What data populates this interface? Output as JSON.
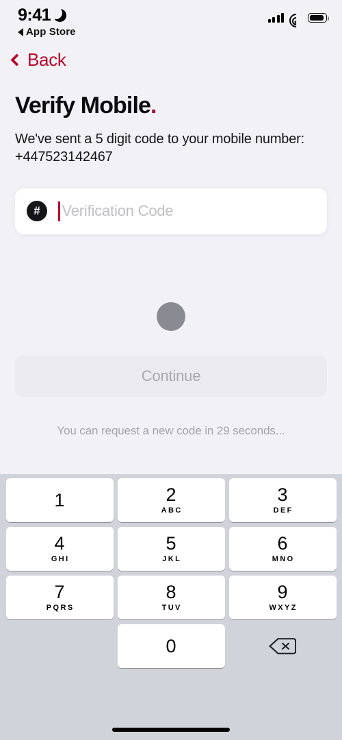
{
  "status_bar": {
    "time": "9:41",
    "dnd_icon": "moon-icon",
    "return_app_label": "App Store",
    "signal_icon": "cellular-signal-icon",
    "wifi_icon": "wifi-icon",
    "battery_icon": "battery-icon"
  },
  "nav": {
    "back_label": "Back",
    "back_icon": "chevron-left-icon"
  },
  "screen": {
    "title": "Verify Mobile",
    "title_accent": ".",
    "subtitle": "We've sent a 5 digit code to your mobile number: +447523142467"
  },
  "verification_input": {
    "icon": "hash-icon",
    "icon_glyph": "#",
    "value": "",
    "placeholder": "Verification Code"
  },
  "loading": {
    "indicator": "loading-spinner"
  },
  "actions": {
    "continue_label": "Continue",
    "continue_enabled": false,
    "resend_text": "You can request a new code in 29 seconds..."
  },
  "keypad": {
    "rows": [
      [
        {
          "digit": "1",
          "letters": ""
        },
        {
          "digit": "2",
          "letters": "ABC"
        },
        {
          "digit": "3",
          "letters": "DEF"
        }
      ],
      [
        {
          "digit": "4",
          "letters": "GHI"
        },
        {
          "digit": "5",
          "letters": "JKL"
        },
        {
          "digit": "6",
          "letters": "MNO"
        }
      ],
      [
        {
          "digit": "7",
          "letters": "PQRS"
        },
        {
          "digit": "8",
          "letters": "TUV"
        },
        {
          "digit": "9",
          "letters": "WXYZ"
        }
      ],
      [
        {
          "digit": "",
          "letters": ""
        },
        {
          "digit": "0",
          "letters": ""
        },
        {
          "digit": "delete",
          "letters": ""
        }
      ]
    ],
    "delete_icon": "backspace-icon"
  },
  "colors": {
    "accent_red": "#B90A2F",
    "title_accent_red": "#9E0C2C",
    "page_background": "#F2F1F6",
    "keyboard_background": "#D1D3DB",
    "disabled_button": "#EBEAEE",
    "disabled_text": "#A9A8B2"
  }
}
